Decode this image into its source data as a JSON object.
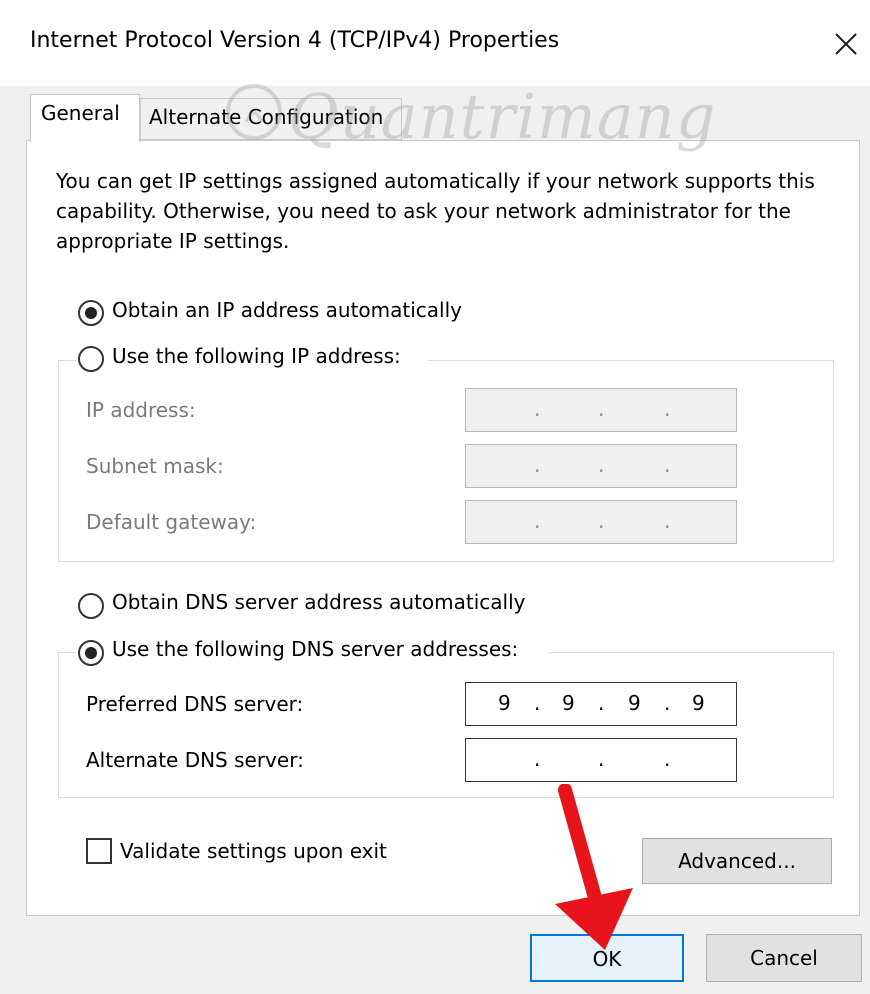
{
  "window": {
    "title": "Internet Protocol Version 4 (TCP/IPv4) Properties",
    "close_icon": "close-icon"
  },
  "watermark": {
    "text": "Quantrimang"
  },
  "tabs": [
    {
      "label": "General",
      "active": true
    },
    {
      "label": "Alternate Configuration",
      "active": false
    }
  ],
  "description": "You can get IP settings assigned automatically if your network supports this capability. Otherwise, you need to ask your network administrator for the appropriate IP settings.",
  "ip_section": {
    "auto_label": "Obtain an IP address automatically",
    "auto_selected": true,
    "manual_label": "Use the following IP address:",
    "manual_selected": false,
    "fields": [
      {
        "label": "IP address:",
        "value": [
          ".",
          ".",
          "."
        ]
      },
      {
        "label": "Subnet mask:",
        "value": [
          ".",
          ".",
          "."
        ]
      },
      {
        "label": "Default gateway:",
        "value": [
          ".",
          ".",
          "."
        ]
      }
    ]
  },
  "dns_section": {
    "auto_label": "Obtain DNS server address automatically",
    "auto_selected": false,
    "manual_label": "Use the following DNS server addresses:",
    "manual_selected": true,
    "preferred_label": "Preferred DNS server:",
    "preferred_octets": [
      "9",
      "9",
      "9",
      "9"
    ],
    "alternate_label": "Alternate DNS server:",
    "alternate_octets": [
      "",
      "",
      "",
      ""
    ],
    "dot": "."
  },
  "validate_label": "Validate settings upon exit",
  "validate_checked": false,
  "buttons": {
    "advanced": "Advanced...",
    "ok": "OK",
    "cancel": "Cancel"
  },
  "colors": {
    "accent": "#0078d7",
    "arrow": "#e8141b"
  }
}
